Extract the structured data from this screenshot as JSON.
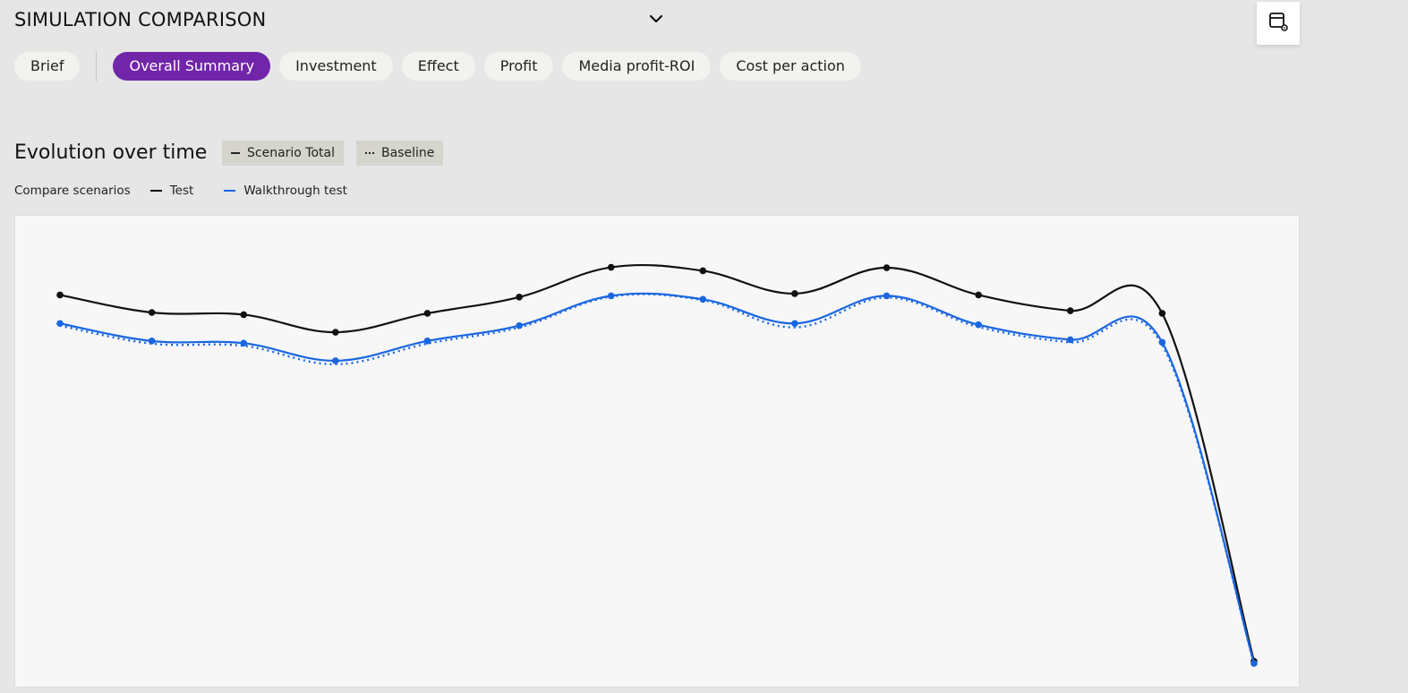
{
  "header": {
    "title": "SIMULATION COMPARISON"
  },
  "icons": {
    "dropdown": "chevron-down-icon",
    "settings": "calendar-settings-icon"
  },
  "tabs": [
    {
      "label": "Brief",
      "active": false
    },
    {
      "label": "Overall Summary",
      "active": true
    },
    {
      "label": "Investment",
      "active": false
    },
    {
      "label": "Effect",
      "active": false
    },
    {
      "label": "Profit",
      "active": false
    },
    {
      "label": "Media profit-ROI",
      "active": false
    },
    {
      "label": "Cost per action",
      "active": false
    }
  ],
  "section": {
    "title": "Evolution over time",
    "legend_chips": [
      {
        "label": "Scenario Total",
        "style": "solid"
      },
      {
        "label": "Baseline",
        "style": "dotted"
      }
    ],
    "compare_label": "Compare scenarios",
    "scenarios": [
      {
        "name": "Test",
        "color": "#111111"
      },
      {
        "name": "Walkthrough test",
        "color": "#1a66e0"
      }
    ]
  },
  "colors": {
    "accent": "#7125a8",
    "test": "#111111",
    "walkthrough": "#1a66e0"
  },
  "chart_data": {
    "type": "line",
    "x": [
      1,
      2,
      3,
      4,
      5,
      6,
      7,
      8,
      9,
      10,
      11,
      12,
      13,
      14
    ],
    "ylim": [
      0,
      100
    ],
    "grid": false,
    "series": [
      {
        "name": "Test",
        "style": "solid",
        "values": [
          84,
          80,
          79.5,
          75.5,
          79.8,
          83.5,
          90.3,
          89.5,
          84.3,
          90.2,
          84,
          80.4,
          79.8,
          0.5
        ]
      },
      {
        "name": "Walkthrough test",
        "style": "solid",
        "values": [
          77.5,
          73.5,
          73,
          69,
          73.5,
          77,
          83.8,
          83,
          77.5,
          83.8,
          77.2,
          73.8,
          73.2,
          0
        ]
      },
      {
        "name": "Walkthrough test",
        "style": "dotted",
        "values": [
          77,
          72.9,
          72.4,
          68.2,
          72.9,
          76.6,
          83.6,
          82.8,
          76.6,
          83.4,
          76.7,
          73.2,
          72.6,
          0
        ]
      }
    ]
  }
}
